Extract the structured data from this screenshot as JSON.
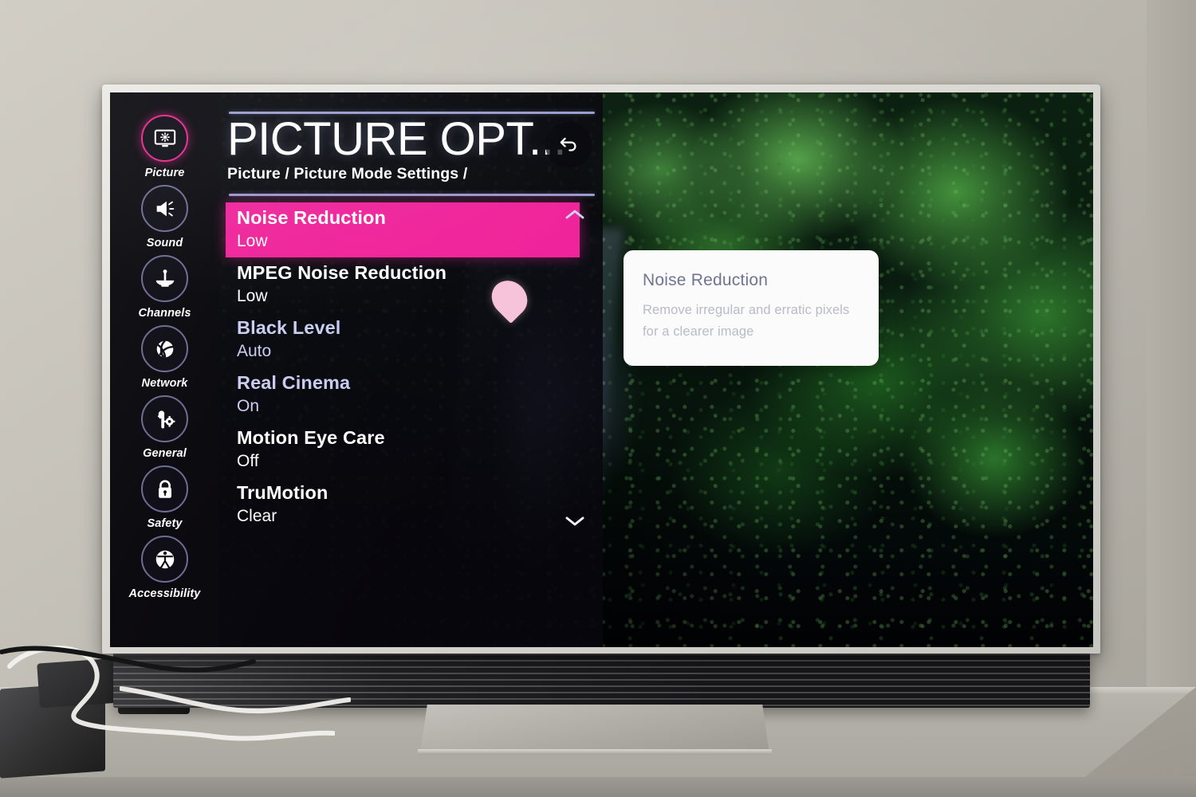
{
  "device": {
    "type": "television",
    "os_ui": "webOS Settings"
  },
  "sidebar": {
    "items": [
      {
        "label": "Picture",
        "icon": "monitor-brightness-icon",
        "active": true
      },
      {
        "label": "Sound",
        "icon": "speaker-icon",
        "active": false
      },
      {
        "label": "Channels",
        "icon": "satellite-dish-icon",
        "active": false
      },
      {
        "label": "Network",
        "icon": "network-globe-icon",
        "active": false
      },
      {
        "label": "General",
        "icon": "wrench-gear-icon",
        "active": false
      },
      {
        "label": "Safety",
        "icon": "padlock-icon",
        "active": false
      },
      {
        "label": "Accessibility",
        "icon": "accessibility-icon",
        "active": false
      }
    ]
  },
  "header": {
    "title": "PICTURE OPT...",
    "breadcrumb": "Picture / Picture Mode Settings /",
    "back_icon": "back-arrow-icon"
  },
  "menu": {
    "scroll_up_icon": "chevron-up-icon",
    "scroll_down_icon": "chevron-down-icon",
    "items": [
      {
        "label": "Noise Reduction",
        "value": "Low",
        "selected": true,
        "bright": true
      },
      {
        "label": "MPEG Noise Reduction",
        "value": "Low",
        "selected": false,
        "bright": true
      },
      {
        "label": "Black Level",
        "value": "Auto",
        "selected": false,
        "bright": false
      },
      {
        "label": "Real Cinema",
        "value": "On",
        "selected": false,
        "bright": false
      },
      {
        "label": "Motion Eye Care",
        "value": "Off",
        "selected": false,
        "bright": true
      },
      {
        "label": "TruMotion",
        "value": "Clear",
        "selected": false,
        "bright": true
      }
    ]
  },
  "tooltip": {
    "title": "Noise Reduction",
    "body": "Remove irregular and erratic pixels for a clearer image"
  },
  "cursor": {
    "icon": "pointer-blob-cursor"
  },
  "colors": {
    "accent_pink": "#f0239a",
    "panel_bg": "#08070e",
    "sidebar_bg": "#09080d",
    "rule": "#9a9ccd",
    "label_dim": "#c9ccf2",
    "tooltip_bg": "#fbfbfc",
    "tooltip_title": "#6f7490",
    "tooltip_body": "#b8bbc8"
  },
  "environment": {
    "wall": "#c6c2b9",
    "desk": "#b3b0a8",
    "tv_bezel": "#dcdad5",
    "speaker_bar": "#1b1b1d"
  }
}
